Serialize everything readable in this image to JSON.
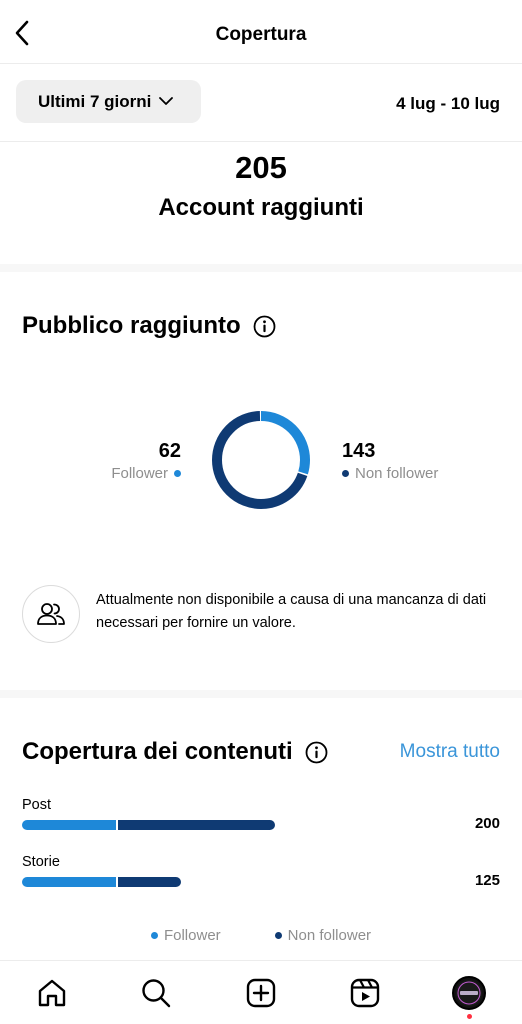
{
  "header": {
    "title": "Copertura",
    "back_icon": "chevron-left-icon"
  },
  "filter": {
    "range_label": "Ultimi 7 giorni",
    "date_range": "4 lug - 10 lug"
  },
  "summary": {
    "total": "205",
    "label": "Account raggiunti"
  },
  "audience": {
    "title": "Pubblico raggiunto",
    "followers": {
      "value": "62",
      "label": "Follower"
    },
    "non_followers": {
      "value": "143",
      "label": "Non follower"
    },
    "unavailable_text": "Attualmente non disponibile a causa di una mancanza di dati necessari per fornire un valore."
  },
  "content_reach": {
    "title": "Copertura dei contenuti",
    "show_all": "Mostra tutto",
    "rows": [
      {
        "label": "Post",
        "value": "200"
      },
      {
        "label": "Storie",
        "value": "125"
      }
    ],
    "legend": {
      "followers": "Follower",
      "non_followers": "Non follower"
    }
  },
  "colors": {
    "follower": "#1e88d8",
    "non_follower": "#0f3a73",
    "link": "#3a95d9",
    "notification": "#ff3040"
  },
  "chart_data": [
    {
      "type": "pie",
      "categories": [
        "Follower",
        "Non follower"
      ],
      "values": [
        62,
        143
      ]
    },
    {
      "type": "bar",
      "categories": [
        "Post",
        "Storie"
      ],
      "totals": [
        200,
        125
      ],
      "series": [
        {
          "name": "Follower",
          "values": [
            75,
            75
          ]
        },
        {
          "name": "Non follower",
          "values": [
            125,
            50
          ]
        }
      ]
    }
  ],
  "tabbar": {
    "icons": [
      "home-icon",
      "search-icon",
      "create-icon",
      "reels-icon",
      "profile-avatar"
    ]
  }
}
